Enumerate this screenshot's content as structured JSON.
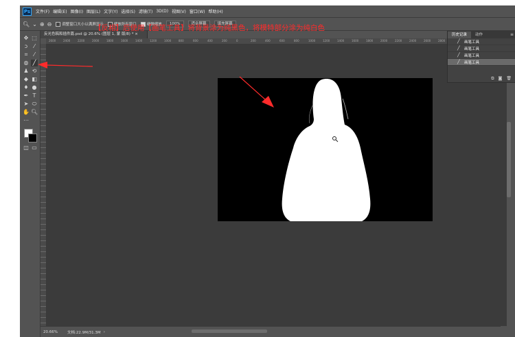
{
  "app": {
    "logo": "Ps"
  },
  "menubar": {
    "items": [
      "文件(F)",
      "编辑(E)",
      "图像(I)",
      "图层(L)",
      "文字(Y)",
      "选择(S)",
      "滤镜(T)",
      "3D(D)",
      "视图(V)",
      "窗口(W)",
      "帮助(H)"
    ]
  },
  "options": {
    "zoom_icon": "zoom-icon",
    "checks": [
      {
        "label": "调整窗口大小以满屏显示",
        "checked": false
      },
      {
        "label": "缩放所有窗口",
        "checked": false
      },
      {
        "label": "细微缩放",
        "checked": true
      }
    ],
    "buttons": [
      "100%",
      "适合屏幕",
      "填充屏幕"
    ]
  },
  "document": {
    "tab_title": "反光色稿和插件篇.psd @ 20.6% (图层 1, 蒙 版/8) * ×",
    "ruler_ticks": [
      "2600",
      "2400",
      "2200",
      "2000",
      "1800",
      "1600",
      "1400",
      "1200",
      "1000",
      "800",
      "600",
      "400",
      "200",
      "0",
      "200",
      "400",
      "600",
      "800",
      "1000",
      "1200",
      "1400",
      "1600",
      "1800",
      "2000",
      "2200",
      "2400",
      "2600",
      "2800",
      "3000",
      "3200",
      "3400"
    ]
  },
  "annotation": {
    "text": "【反相】后使用【画笔工具】将背景涂为纯黑色，将模特部分涂为纯白色",
    "color": "#ff2b2b"
  },
  "history": {
    "tabs": [
      "历史记录",
      "动作"
    ],
    "menu_icon": "panel-menu-icon",
    "items": [
      {
        "label": "画笔工具",
        "selected": false
      },
      {
        "label": "画笔工具",
        "selected": false
      },
      {
        "label": "画笔工具",
        "selected": false
      },
      {
        "label": "画笔工具",
        "selected": true
      }
    ],
    "footer_icons": [
      "new-snapshot-icon",
      "camera-icon",
      "trash-icon"
    ]
  },
  "status": {
    "zoom": "20.66%",
    "doc_info": "文档:22.9M/31.3M"
  },
  "colors": {
    "accent": "#31a8ff",
    "annotation": "#ff2b2b",
    "foreground": "#ffffff",
    "background": "#000000"
  }
}
